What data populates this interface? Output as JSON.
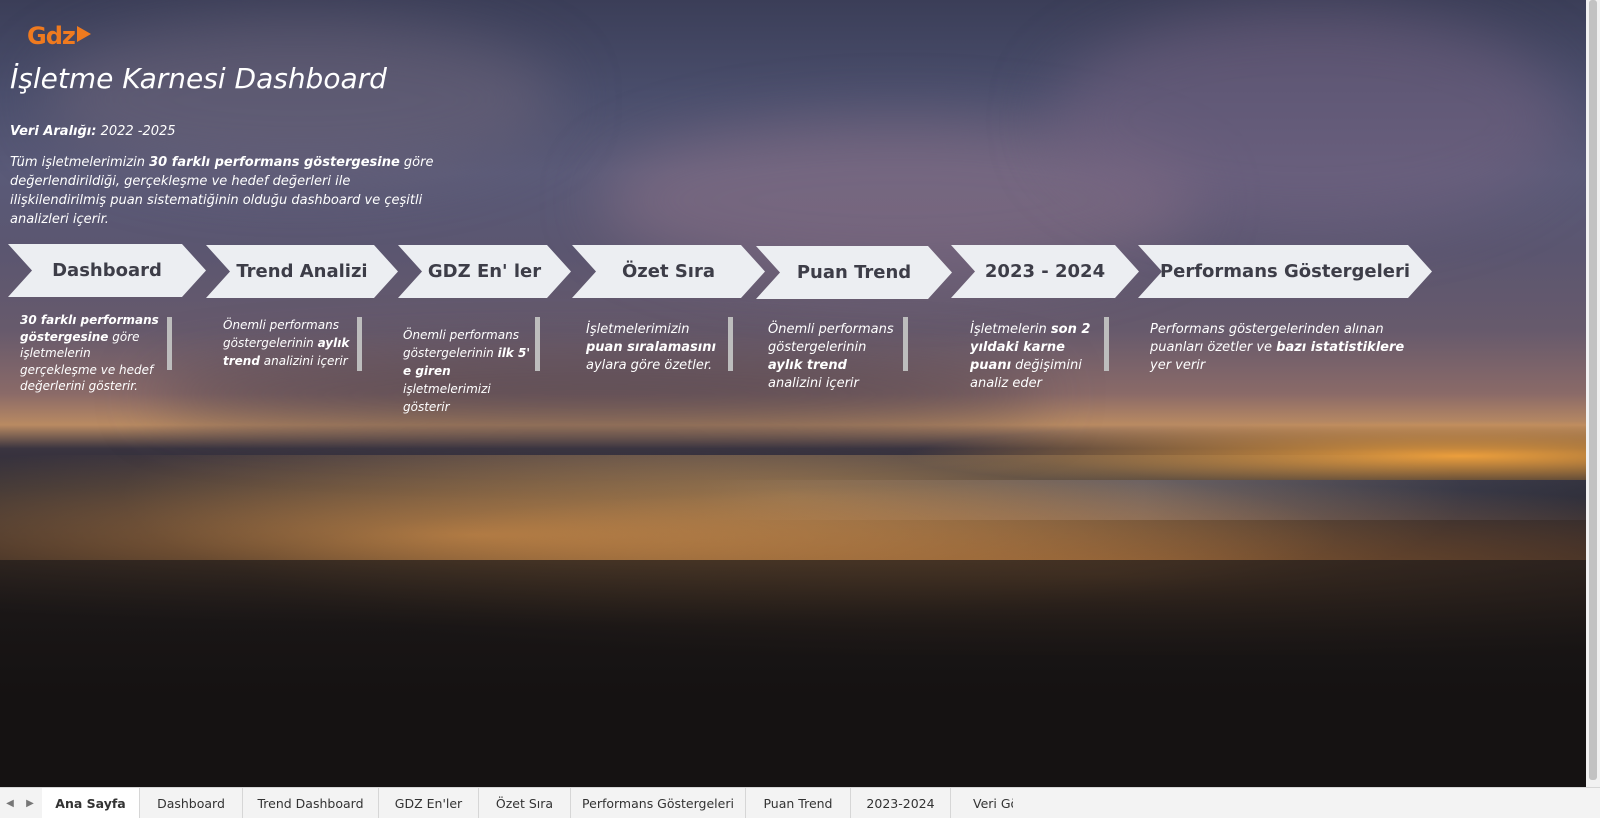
{
  "logo": {
    "text": "Gdz"
  },
  "header": {
    "title": "İşletme Karnesi Dashboard",
    "range_label": "Veri Aralığı:",
    "range_value": " 2022 -2025",
    "desc_1": "Tüm işletmelerimizin ",
    "desc_2": "30 farklı performans  göstergesine",
    "desc_3": " göre değerlendirildiği,  gerçekleşme ve hedef değerleri ile ilişkilendirilmiş puan sistematiğinin olduğu dashboard ve  çeşitli analizleri içerir."
  },
  "nav_buttons": [
    {
      "label": "Dashboard"
    },
    {
      "label": "Trend Analizi"
    },
    {
      "label": "GDZ En' ler"
    },
    {
      "label": "Özet Sıra"
    },
    {
      "label": "Puan Trend"
    },
    {
      "label": "2023 - 2024"
    },
    {
      "label": "Performans Göstergeleri"
    }
  ],
  "notes": {
    "n1": {
      "b1": "30 farklı performans göstergesine",
      "t1": " göre işletmelerin gerçekleşme ve hedef değerlerini gösterir."
    },
    "n2": {
      "t1": "Önemli performans göstergelerinin ",
      "b1": "aylık trend",
      "t2": " analizini içerir"
    },
    "n3": {
      "t1": "Önemli performans göstergelerinin ",
      "b1": "ilk 5' e giren",
      "t2": " işletmelerimizi gösterir"
    },
    "n4": {
      "t1": "İşletmelerimizin ",
      "b1": "puan sıralamasını",
      "t2": " aylara göre özetler."
    },
    "n5": {
      "t1": "Önemli performans göstergelerinin ",
      "b1": "aylık trend",
      "t2": " analizini içerir"
    },
    "n6": {
      "t1": "İşletmelerin ",
      "b1": "son 2 yıldaki karne puanı",
      "t2": " değişimini analiz eder"
    },
    "n7": {
      "t1": "Performans  göstergelerinden alınan puanları özetler ve ",
      "b1": "bazı istatistiklere",
      "t2": " yer verir"
    }
  },
  "sheet_tabs": [
    {
      "label": "Ana Sayfa",
      "active": true
    },
    {
      "label": "Dashboard"
    },
    {
      "label": "Trend Dashboard"
    },
    {
      "label": "GDZ En'ler"
    },
    {
      "label": "Özet Sıra"
    },
    {
      "label": "Performans Göstergeleri"
    },
    {
      "label": "Puan Trend"
    },
    {
      "label": "2023-2024"
    },
    {
      "label": "Veri Gö"
    }
  ],
  "colors": {
    "brand": "#ef7a1f",
    "chevron": "#eceef2",
    "chevron_text": "#3d3d48"
  }
}
